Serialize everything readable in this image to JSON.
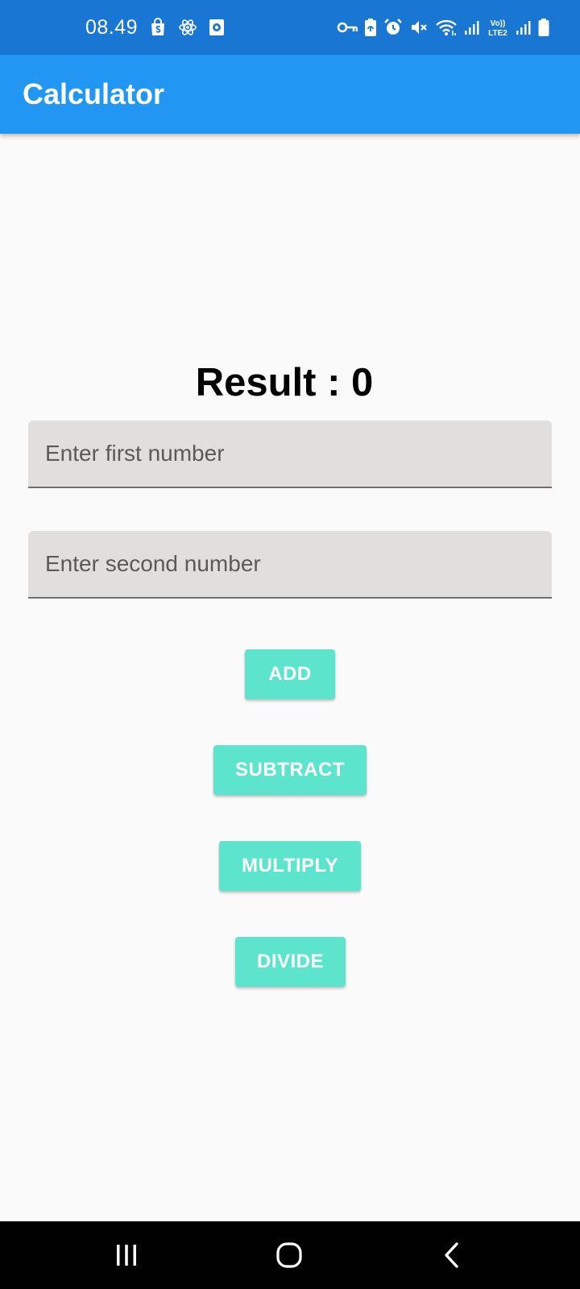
{
  "status_bar": {
    "time": "08.49",
    "left_icons": [
      "shopping-bag-icon",
      "atom-icon",
      "screen-record-icon"
    ],
    "right_icons": [
      "vpn-key-icon",
      "battery-saver-icon",
      "alarm-icon",
      "mute-icon",
      "wifi-icon",
      "signal-icon",
      "volte-lte2-icon",
      "signal-2-icon",
      "battery-icon"
    ],
    "lte_label_top": "Vo))",
    "lte_label_bottom": "LTE2"
  },
  "app_bar": {
    "title": "Calculator",
    "color": "#2196f3",
    "status_color": "#1976d2"
  },
  "result": {
    "text": "Result : 0"
  },
  "inputs": {
    "first": {
      "placeholder": "Enter first number",
      "value": ""
    },
    "second": {
      "placeholder": "Enter second number",
      "value": ""
    }
  },
  "buttons": {
    "add": "ADD",
    "subtract": "SUBTRACT",
    "multiply": "MULTIPLY",
    "divide": "DIVIDE",
    "color": "#5ce5cc"
  },
  "nav_bar": {
    "icons": [
      "recents-icon",
      "home-icon",
      "back-icon"
    ]
  }
}
